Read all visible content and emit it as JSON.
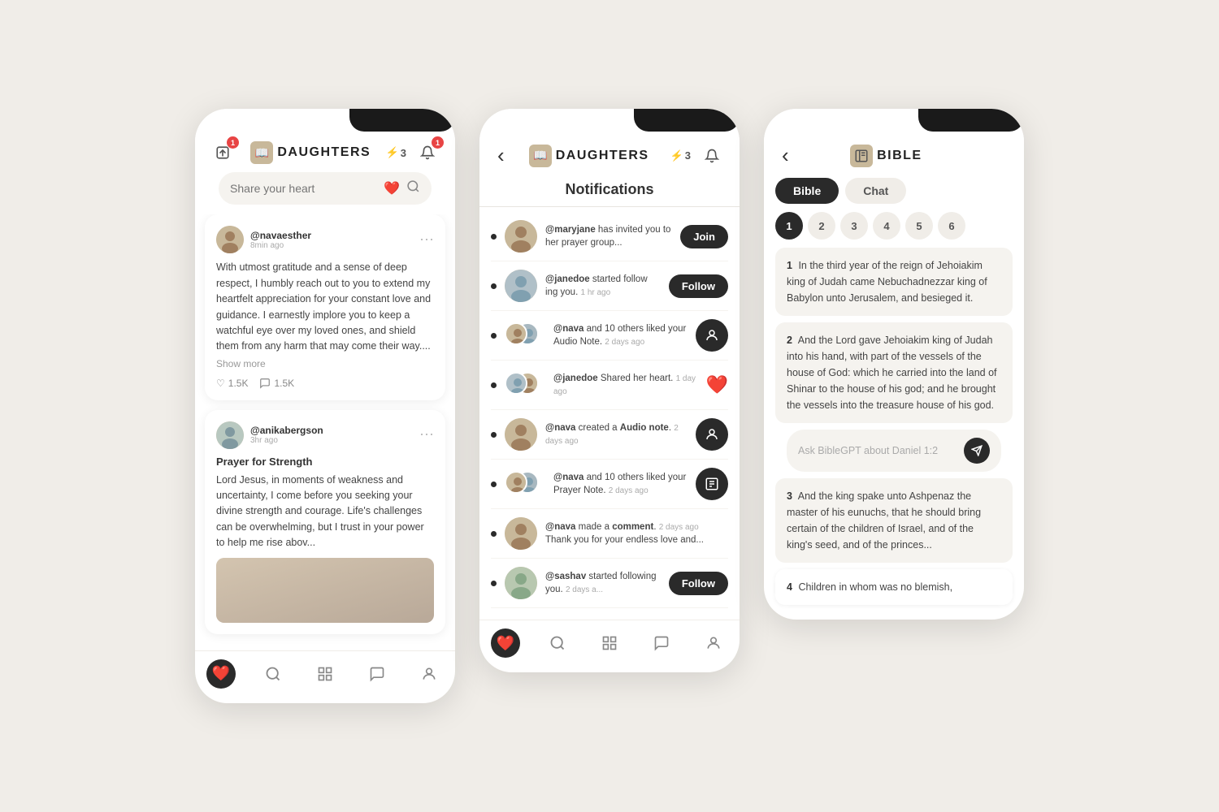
{
  "phone1": {
    "notch": true,
    "header": {
      "upload_icon": "⬆",
      "logo_icon": "📖",
      "logo_text": "DAUGHTERS",
      "lightning": "⚡",
      "lightning_count": "3",
      "bell_icon": "🔔",
      "bell_badge": "1"
    },
    "search": {
      "placeholder": "Share your heart",
      "heart": "❤️",
      "search_icon": "🔍"
    },
    "posts": [
      {
        "avatar": "👩",
        "username": "@navaesther",
        "time": "8min ago",
        "text": "With utmost gratitude and a sense of deep respect, I humbly reach out to you to extend my heartfelt appreciation for your constant love and guidance. I earnestly implore you to keep a watchful eye over my loved ones, and shield them from any harm that may come their way....",
        "show_more": "Show more",
        "likes": "1.5K",
        "comments": "1.5K",
        "like_icon": "♡",
        "comment_icon": "💬"
      },
      {
        "avatar": "👩",
        "username": "@anikabergson",
        "time": "3hr ago",
        "title": "Prayer for Strength",
        "text": "Lord Jesus, in moments of weakness and uncertainty, I come before you seeking your divine strength and courage. Life's challenges can be overwhelming, but I trust in your power to help me rise abov...",
        "like_icon": "♡",
        "comment_icon": "💬"
      }
    ],
    "bottom_nav": [
      "❤️",
      "🔍",
      "⊞",
      "💬",
      "👤"
    ]
  },
  "phone2": {
    "notch": true,
    "back_icon": "‹",
    "title": "Notifications",
    "header": {
      "logo_icon": "📖",
      "logo_text": "DAUGHTERS",
      "lightning": "⚡",
      "lightning_count": "3",
      "bell_icon": "🔔"
    },
    "notifications": [
      {
        "type": "join",
        "avatar": "👩",
        "text": "@maryjane has invited you to her prayer group...",
        "action": "Join",
        "unread": true
      },
      {
        "type": "follow",
        "avatar": "👩",
        "text": "@janedoe started following you.",
        "time": "1 hr ago",
        "action": "Follow",
        "unread": true
      },
      {
        "type": "like_audio",
        "avatar": "👩",
        "text": "@nava and 10 others liked your Audio Note.",
        "time": "2 days ago",
        "icon": "👤",
        "unread": true
      },
      {
        "type": "heart",
        "avatar": "👩",
        "text": "@janedoe Shared her heart.",
        "time": "1 day ago",
        "heart": "❤️",
        "unread": true
      },
      {
        "type": "audio",
        "avatar": "👩",
        "text": "@nava created a Audio note.",
        "time": "2 days ago",
        "icon": "👤",
        "unread": true
      },
      {
        "type": "prayer_like",
        "avatar": "👩",
        "text": "@nava and 10 others liked your Prayer Note.",
        "time": "2 days ago",
        "icon": "📋",
        "unread": true
      },
      {
        "type": "comment",
        "avatar": "👩",
        "text": "@nava made a comment.",
        "time": "2 days ago",
        "subtext": "Thank you for your endless love and...",
        "unread": true
      },
      {
        "type": "follow2",
        "avatar": "👩",
        "text": "@sashav started following you.",
        "time": "2 days a...",
        "action": "Follow",
        "unread": true
      }
    ],
    "bottom_nav": [
      "❤️",
      "🔍",
      "⊞",
      "💬",
      "👤"
    ]
  },
  "phone3": {
    "notch": true,
    "back_icon": "‹",
    "header_title": "BIBLE",
    "header_icon": "📖",
    "tabs": [
      "Bible",
      "Chat"
    ],
    "active_tab": "Bible",
    "active_tab_label": "Bible",
    "chat_tab_label": "Chat",
    "chapters": [
      "1",
      "2",
      "3",
      "4",
      "5",
      "6"
    ],
    "active_chapter": "1",
    "verses": [
      {
        "num": "1",
        "text": "In the third year of the reign of Jehoiakim king of Judah came Nebuchadnezzar king of Babylon unto Jerusalem, and besieged it."
      },
      {
        "num": "2",
        "text": "And the Lord gave Jehoiakim king of Judah into his hand, with part of the vessels of the house of God: which he carried into the land of Shinar to the house of his god; and he brought the vessels into the treasure house of his god."
      },
      {
        "num": "3",
        "text": "And the king spake unto Ashpenaz the master of his eunuchs, that he should bring certain of the children of Israel, and of the king's seed, and of the princes..."
      },
      {
        "num": "4",
        "text": "Children in whom was no blemish,"
      }
    ],
    "chat_placeholder": "Ask BibleGPT about Daniel 1:2",
    "send_icon": "➤"
  }
}
